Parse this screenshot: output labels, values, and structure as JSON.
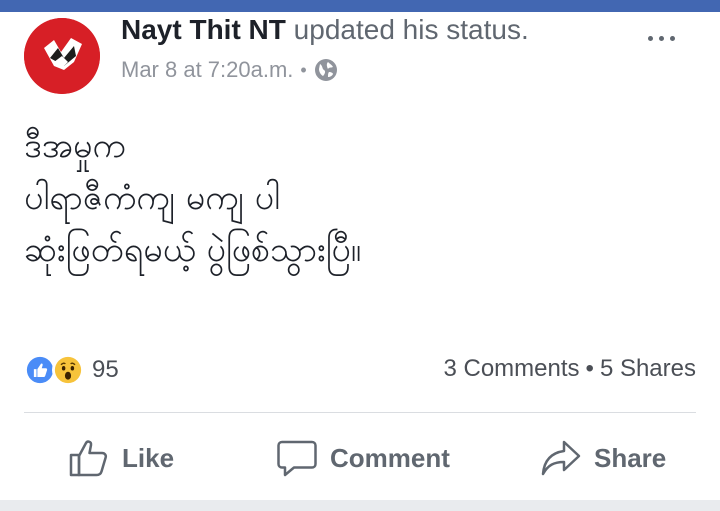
{
  "post": {
    "author": "Nayt Thit NT",
    "action": "updated his status.",
    "time": "Mar 8 at 7:20a.m.",
    "separator": "•",
    "privacy_icon": "globe-icon",
    "body_lines": [
      "ဒီအမှုက",
      "ပါရာဇီကံကျ မကျ ပါ",
      "ဆုံးဖြတ်ရမယ့် ပွဲဖြစ်သွားပြီ။"
    ]
  },
  "stats": {
    "reaction_count": "95",
    "comments": "3 Comments",
    "separator": "•",
    "shares": "5 Shares"
  },
  "actions": {
    "like_label": "Like",
    "comment_label": "Comment",
    "share_label": "Share"
  },
  "colors": {
    "brand_blue": "#4267b2",
    "avatar_red": "#d71f26",
    "secondary_text": "#606770",
    "meta_text": "#90949c"
  }
}
